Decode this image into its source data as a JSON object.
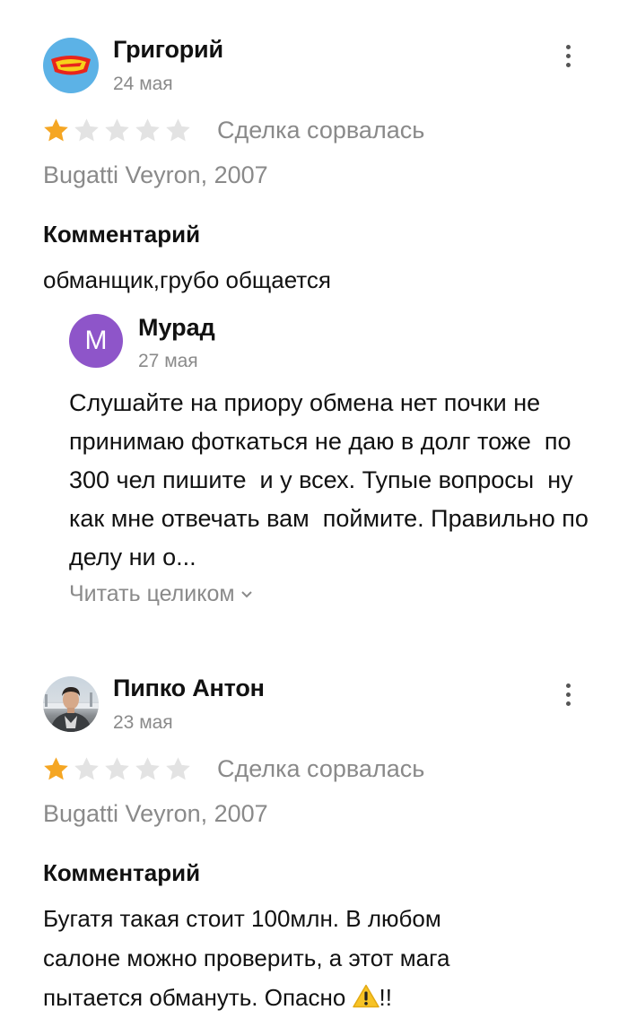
{
  "reviews": [
    {
      "author": "Григорий",
      "date": "24 мая",
      "avatar": "hot-wheels-logo",
      "rating": 1,
      "rating_max": 5,
      "status": "Сделка сорвалась",
      "car": "Bugatti Veyron, 2007",
      "comment_heading": "Комментарий",
      "comment": "обманщик,грубо общается",
      "reply": {
        "author": "Мурад",
        "avatar_letter": "М",
        "date": "27 мая",
        "text": "Слушайте на приору обмена нет почки не принимаю фоткаться не даю в долг тоже  по 300 чел пишите  и у всех. Тупые вопросы  ну как мне отвечать вам  поймите. Правильно по делу ни о...",
        "read_more": "Читать целиком"
      }
    },
    {
      "author": "Пипко Антон",
      "date": "23 мая",
      "avatar": "user-photo",
      "rating": 1,
      "rating_max": 5,
      "status": "Сделка сорвалась",
      "car": "Bugatti Veyron, 2007",
      "comment_heading": "Комментарий",
      "comment_lines": [
        "Бугатя такая стоит 100млн. В любом",
        "салоне можно проверить, а этот мага",
        "пытается обмануть. Опасно "
      ],
      "comment_suffix": "!!"
    }
  ],
  "colors": {
    "star_filled": "#f5a623",
    "star_empty": "#e3e3e3",
    "muted_text": "#8a8a8a",
    "reply_avatar": "#8e55c9",
    "hot_wheels_bg": "#5cb2e6"
  },
  "icons": [
    "kebab-menu-icon",
    "star-icon",
    "chevron-down-icon",
    "warning-icon"
  ]
}
